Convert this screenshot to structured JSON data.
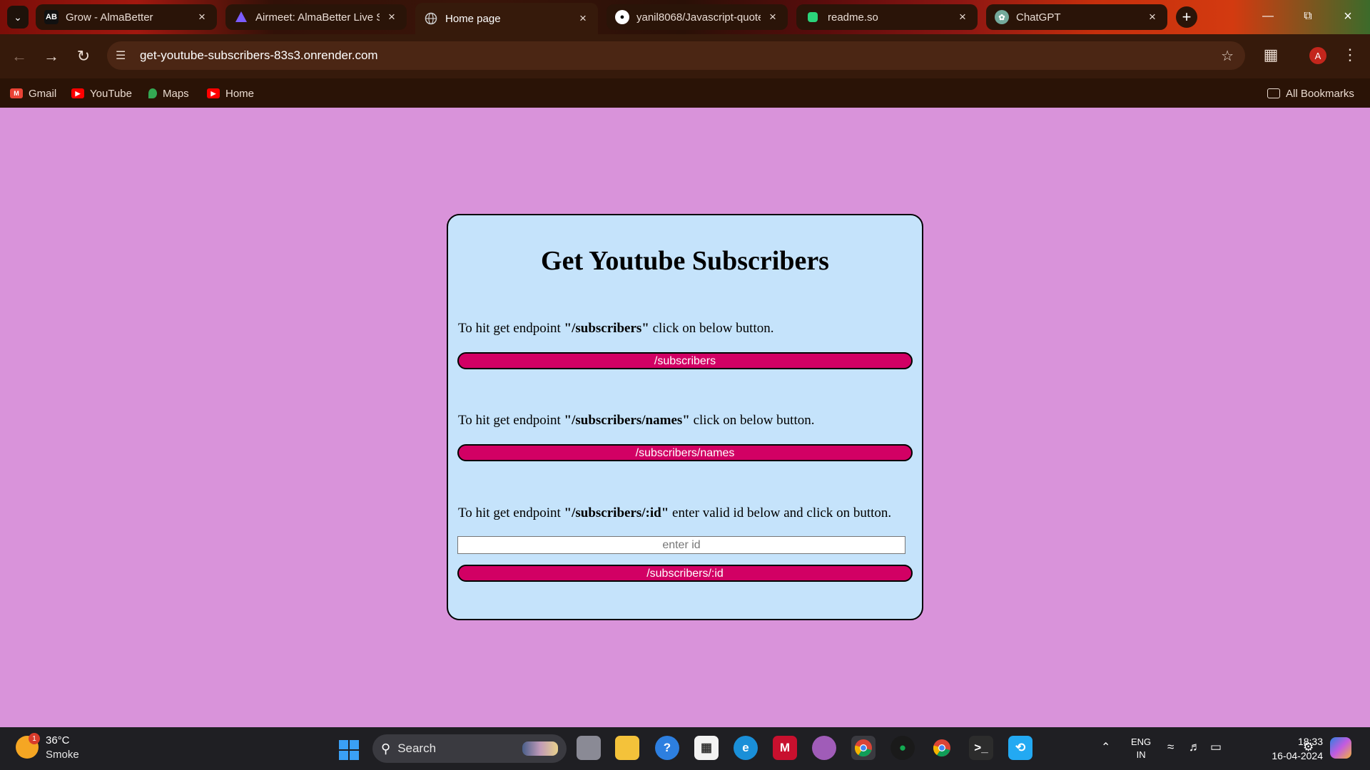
{
  "tabs": [
    {
      "title": "Grow - AlmaBetter",
      "favicon": "AB",
      "color": "#111111"
    },
    {
      "title": "Airmeet: AlmaBetter Live S",
      "favicon": "airmeet-icon",
      "color": "#7b5cff"
    },
    {
      "title": "Home page",
      "favicon": "globe-icon",
      "color": "#777777"
    },
    {
      "title": "yanil8068/Javascript-quote",
      "favicon": "github-icon",
      "color": "#ffffff"
    },
    {
      "title": "readme.so",
      "favicon": "readme-icon",
      "color": "#2bd47a"
    },
    {
      "title": "ChatGPT",
      "favicon": "chatgpt-icon",
      "color": "#74aa9c"
    }
  ],
  "address_bar": {
    "url": "get-youtube-subscribers-83s3.onrender.com"
  },
  "bookmarks": [
    {
      "label": "Gmail",
      "icon": "gmail-icon",
      "color": "#ea4335"
    },
    {
      "label": "YouTube",
      "icon": "youtube-icon",
      "color": "#ff0000"
    },
    {
      "label": "Maps",
      "icon": "maps-icon",
      "color": "#34a853"
    },
    {
      "label": "Home",
      "icon": "youtube-icon",
      "color": "#ff0000"
    }
  ],
  "all_bookmarks_label": "All Bookmarks",
  "profile_initial": "A",
  "page": {
    "title": "Get Youtube Subscribers",
    "sections": [
      {
        "prefix": "To hit get endpoint ",
        "endpoint": "\"/subscribers\"",
        "suffix": " click on below button.",
        "button": "/subscribers"
      },
      {
        "prefix": "To hit get endpoint ",
        "endpoint": "\"/subscribers/names\"",
        "suffix": " click on below button.",
        "button": "/subscribers/names"
      },
      {
        "prefix": "To hit get endpoint ",
        "endpoint": "\"/subscribers/:id\"",
        "suffix": " enter valid id below and click on button.",
        "button": "/subscribers/:id"
      }
    ],
    "id_input": {
      "placeholder": "enter id",
      "value": ""
    },
    "colors": {
      "background": "#d993da",
      "card": "#c5e3fb",
      "button": "#d20064"
    }
  },
  "taskbar": {
    "weather": {
      "temp": "36°C",
      "desc": "Smoke",
      "badge": "1"
    },
    "search_label": "Search",
    "lang": {
      "line1": "ENG",
      "line2": "IN"
    },
    "time": "18:33",
    "date": "16-04-2024"
  }
}
